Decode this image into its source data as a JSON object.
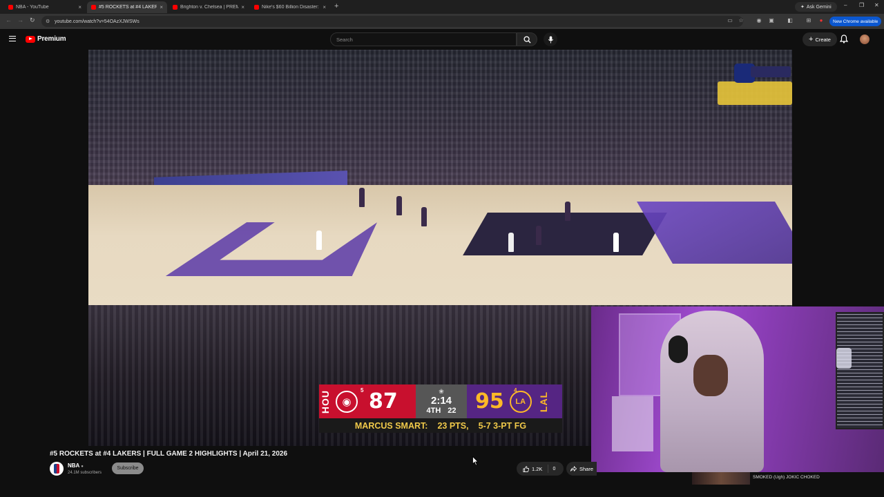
{
  "browser": {
    "tabs": [
      {
        "title": "NBA - YouTube",
        "active": false
      },
      {
        "title": "#5 ROCKETS at #4 LAKERS",
        "active": true
      },
      {
        "title": "Brighton v. Chelsea | PREMIER",
        "active": false
      },
      {
        "title": "Nike's $60 Billion Disaster: Wh",
        "active": false
      }
    ],
    "new_tab_symbol": "+",
    "ask_gemini": "Ask Gemini",
    "url": "youtube.com/watch?v=54OAzXJWSWs",
    "new_chrome": "New Chrome available"
  },
  "youtube": {
    "logo_text": "Premium",
    "search_placeholder": "Search",
    "create_label": "Create"
  },
  "scorebug": {
    "away": {
      "abbr": "HOU",
      "seed": "5",
      "score": "87",
      "color": "#c8102e"
    },
    "home": {
      "abbr": "LAL",
      "seed": "4",
      "score": "95",
      "color": "#552583",
      "logo_text": "LA"
    },
    "clock": "2:14",
    "period": "4TH",
    "shot_clock": "22",
    "ticker": {
      "player": "MARCUS SMART:",
      "pts": "23 PTS,",
      "fg": "5-7 3-PT FG"
    }
  },
  "video": {
    "title": "#5 ROCKETS at #4 LAKERS | FULL GAME 2 HIGHLIGHTS | April 21, 2026",
    "channel": "NBA",
    "subscribers": "24.1M subscribers",
    "subscribe_label": "Subscribe",
    "likes": "1.2K",
    "dislikes": "0",
    "share_label": "Share"
  },
  "recommendation": {
    "title": "SMOKED (Ugh) JOKIC CHOKED"
  },
  "colors": {
    "youtube_red": "#ff0000",
    "rockets_red": "#c8102e",
    "lakers_purple": "#552583",
    "lakers_gold": "#fdb927",
    "chrome_blue": "#0b57d0"
  }
}
